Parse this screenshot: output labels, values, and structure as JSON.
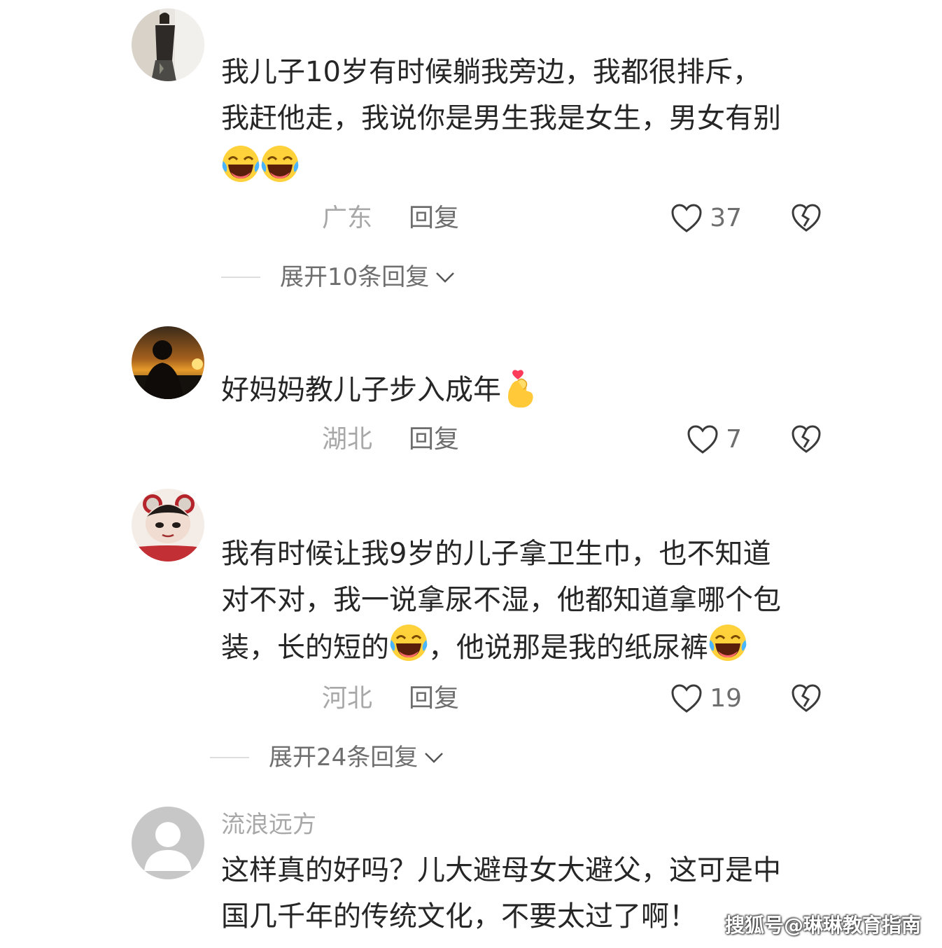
{
  "comments": [
    {
      "username": "",
      "lines": [
        "我儿子10岁有时候躺我旁边，我都很排斥，",
        "我赶他走，我说你是男生我是女生，男女有别"
      ],
      "emoji_line": "😂😂",
      "location": "广东",
      "reply_label": "回复",
      "likes": "37",
      "expand_label": "展开10条回复"
    },
    {
      "username": "",
      "lines": [
        "好妈妈教儿子步入成年"
      ],
      "location": "湖北",
      "reply_label": "回复",
      "likes": "7"
    },
    {
      "username": "",
      "lines": [
        "我有时候让我9岁的儿子拿卫生巾，也不知道",
        "对不对，我一说拿尿不湿，他都知道拿哪个包",
        "装，长的短的",
        "，他说那是我的纸尿裤"
      ],
      "location": "河北",
      "reply_label": "回复",
      "likes": "19",
      "expand_label": "展开24条回复"
    },
    {
      "username": "流浪远方",
      "lines": [
        "这样真的好吗？儿大避母女大避父，这可是中",
        "国几千年的传统文化，不要太过了啊！"
      ]
    }
  ],
  "icons": {
    "like": "heart-outline-icon",
    "dislike": "broken-heart-icon",
    "expand": "chevron-down-icon",
    "emoji_laugh": "laughing-crying-emoji",
    "emoji_heart_hand": "finger-heart-emoji"
  },
  "colors": {
    "text": "#262626",
    "muted": "#a8a8a8",
    "action": "#6e6e6e"
  },
  "watermark": "搜狐号@琳琳教育指南"
}
